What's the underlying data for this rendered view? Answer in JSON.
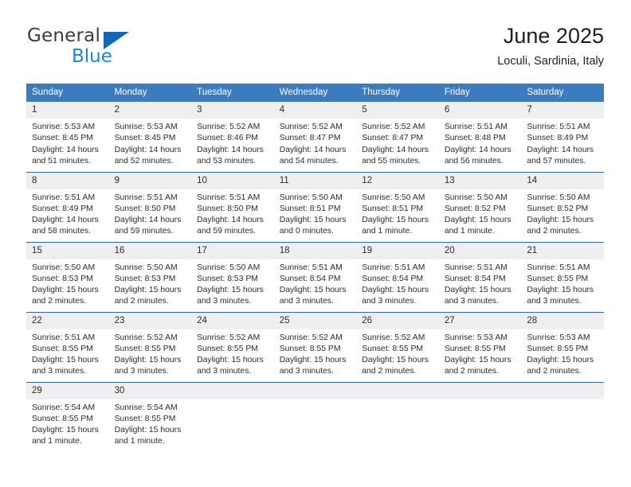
{
  "logo": {
    "word1": "General",
    "word2": "Blue",
    "triangle_color": "#1667b3",
    "blue_color": "#1a86dd"
  },
  "header": {
    "title": "June 2025",
    "subtitle": "Loculi, Sardinia, Italy"
  },
  "theme": {
    "header_blue": "#3b7cc0",
    "row_divider_blue": "#2c6aa8",
    "daynum_background": "#efefef"
  },
  "weekday_headers": [
    "Sunday",
    "Monday",
    "Tuesday",
    "Wednesday",
    "Thursday",
    "Friday",
    "Saturday"
  ],
  "labels": {
    "sunrise_prefix": "Sunrise:",
    "sunset_prefix": "Sunset:",
    "daylight_prefix": "Daylight:"
  },
  "weeks": [
    [
      {
        "day": "1",
        "sunrise": "Sunrise: 5:53 AM",
        "sunset": "Sunset: 8:45 PM",
        "daylight": "Daylight: 14 hours and 51 minutes."
      },
      {
        "day": "2",
        "sunrise": "Sunrise: 5:53 AM",
        "sunset": "Sunset: 8:45 PM",
        "daylight": "Daylight: 14 hours and 52 minutes."
      },
      {
        "day": "3",
        "sunrise": "Sunrise: 5:52 AM",
        "sunset": "Sunset: 8:46 PM",
        "daylight": "Daylight: 14 hours and 53 minutes."
      },
      {
        "day": "4",
        "sunrise": "Sunrise: 5:52 AM",
        "sunset": "Sunset: 8:47 PM",
        "daylight": "Daylight: 14 hours and 54 minutes."
      },
      {
        "day": "5",
        "sunrise": "Sunrise: 5:52 AM",
        "sunset": "Sunset: 8:47 PM",
        "daylight": "Daylight: 14 hours and 55 minutes."
      },
      {
        "day": "6",
        "sunrise": "Sunrise: 5:51 AM",
        "sunset": "Sunset: 8:48 PM",
        "daylight": "Daylight: 14 hours and 56 minutes."
      },
      {
        "day": "7",
        "sunrise": "Sunrise: 5:51 AM",
        "sunset": "Sunset: 8:49 PM",
        "daylight": "Daylight: 14 hours and 57 minutes."
      }
    ],
    [
      {
        "day": "8",
        "sunrise": "Sunrise: 5:51 AM",
        "sunset": "Sunset: 8:49 PM",
        "daylight": "Daylight: 14 hours and 58 minutes."
      },
      {
        "day": "9",
        "sunrise": "Sunrise: 5:51 AM",
        "sunset": "Sunset: 8:50 PM",
        "daylight": "Daylight: 14 hours and 59 minutes."
      },
      {
        "day": "10",
        "sunrise": "Sunrise: 5:51 AM",
        "sunset": "Sunset: 8:50 PM",
        "daylight": "Daylight: 14 hours and 59 minutes."
      },
      {
        "day": "11",
        "sunrise": "Sunrise: 5:50 AM",
        "sunset": "Sunset: 8:51 PM",
        "daylight": "Daylight: 15 hours and 0 minutes."
      },
      {
        "day": "12",
        "sunrise": "Sunrise: 5:50 AM",
        "sunset": "Sunset: 8:51 PM",
        "daylight": "Daylight: 15 hours and 1 minute."
      },
      {
        "day": "13",
        "sunrise": "Sunrise: 5:50 AM",
        "sunset": "Sunset: 8:52 PM",
        "daylight": "Daylight: 15 hours and 1 minute."
      },
      {
        "day": "14",
        "sunrise": "Sunrise: 5:50 AM",
        "sunset": "Sunset: 8:52 PM",
        "daylight": "Daylight: 15 hours and 2 minutes."
      }
    ],
    [
      {
        "day": "15",
        "sunrise": "Sunrise: 5:50 AM",
        "sunset": "Sunset: 8:53 PM",
        "daylight": "Daylight: 15 hours and 2 minutes."
      },
      {
        "day": "16",
        "sunrise": "Sunrise: 5:50 AM",
        "sunset": "Sunset: 8:53 PM",
        "daylight": "Daylight: 15 hours and 2 minutes."
      },
      {
        "day": "17",
        "sunrise": "Sunrise: 5:50 AM",
        "sunset": "Sunset: 8:53 PM",
        "daylight": "Daylight: 15 hours and 3 minutes."
      },
      {
        "day": "18",
        "sunrise": "Sunrise: 5:51 AM",
        "sunset": "Sunset: 8:54 PM",
        "daylight": "Daylight: 15 hours and 3 minutes."
      },
      {
        "day": "19",
        "sunrise": "Sunrise: 5:51 AM",
        "sunset": "Sunset: 8:54 PM",
        "daylight": "Daylight: 15 hours and 3 minutes."
      },
      {
        "day": "20",
        "sunrise": "Sunrise: 5:51 AM",
        "sunset": "Sunset: 8:54 PM",
        "daylight": "Daylight: 15 hours and 3 minutes."
      },
      {
        "day": "21",
        "sunrise": "Sunrise: 5:51 AM",
        "sunset": "Sunset: 8:55 PM",
        "daylight": "Daylight: 15 hours and 3 minutes."
      }
    ],
    [
      {
        "day": "22",
        "sunrise": "Sunrise: 5:51 AM",
        "sunset": "Sunset: 8:55 PM",
        "daylight": "Daylight: 15 hours and 3 minutes."
      },
      {
        "day": "23",
        "sunrise": "Sunrise: 5:52 AM",
        "sunset": "Sunset: 8:55 PM",
        "daylight": "Daylight: 15 hours and 3 minutes."
      },
      {
        "day": "24",
        "sunrise": "Sunrise: 5:52 AM",
        "sunset": "Sunset: 8:55 PM",
        "daylight": "Daylight: 15 hours and 3 minutes."
      },
      {
        "day": "25",
        "sunrise": "Sunrise: 5:52 AM",
        "sunset": "Sunset: 8:55 PM",
        "daylight": "Daylight: 15 hours and 3 minutes."
      },
      {
        "day": "26",
        "sunrise": "Sunrise: 5:52 AM",
        "sunset": "Sunset: 8:55 PM",
        "daylight": "Daylight: 15 hours and 2 minutes."
      },
      {
        "day": "27",
        "sunrise": "Sunrise: 5:53 AM",
        "sunset": "Sunset: 8:55 PM",
        "daylight": "Daylight: 15 hours and 2 minutes."
      },
      {
        "day": "28",
        "sunrise": "Sunrise: 5:53 AM",
        "sunset": "Sunset: 8:55 PM",
        "daylight": "Daylight: 15 hours and 2 minutes."
      }
    ],
    [
      {
        "day": "29",
        "sunrise": "Sunrise: 5:54 AM",
        "sunset": "Sunset: 8:55 PM",
        "daylight": "Daylight: 15 hours and 1 minute."
      },
      {
        "day": "30",
        "sunrise": "Sunrise: 5:54 AM",
        "sunset": "Sunset: 8:55 PM",
        "daylight": "Daylight: 15 hours and 1 minute."
      },
      {
        "day": "",
        "sunrise": "",
        "sunset": "",
        "daylight": ""
      },
      {
        "day": "",
        "sunrise": "",
        "sunset": "",
        "daylight": ""
      },
      {
        "day": "",
        "sunrise": "",
        "sunset": "",
        "daylight": ""
      },
      {
        "day": "",
        "sunrise": "",
        "sunset": "",
        "daylight": ""
      },
      {
        "day": "",
        "sunrise": "",
        "sunset": "",
        "daylight": ""
      }
    ]
  ]
}
